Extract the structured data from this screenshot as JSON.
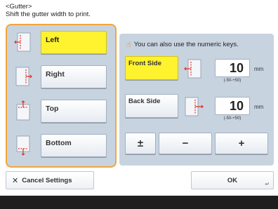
{
  "header": {
    "title": "<Gutter>",
    "instruction": "Shift the gutter width to print."
  },
  "positions": [
    {
      "label": "Left",
      "selected": true,
      "icon": "gutter-left-icon"
    },
    {
      "label": "Right",
      "selected": false,
      "icon": "gutter-right-icon"
    },
    {
      "label": "Top",
      "selected": false,
      "icon": "gutter-top-icon"
    },
    {
      "label": "Bottom",
      "selected": false,
      "icon": "gutter-bottom-icon"
    }
  ],
  "hint": "You can also use the numeric keys.",
  "front": {
    "label": "Front Side",
    "value": "10",
    "unit": "mm",
    "range": "(-50-+50)"
  },
  "back": {
    "label": "Back Side",
    "value": "10",
    "unit": "mm",
    "range": "(-50-+50)"
  },
  "keys": {
    "plusminus": "±",
    "minus": "−",
    "plus": "+"
  },
  "footer": {
    "cancel": "Cancel Settings",
    "ok": "OK"
  },
  "colors": {
    "accent": "#f0a63c",
    "selected": "#fff22e",
    "panel": "#c8d3e0",
    "guide": "#e0302a"
  }
}
